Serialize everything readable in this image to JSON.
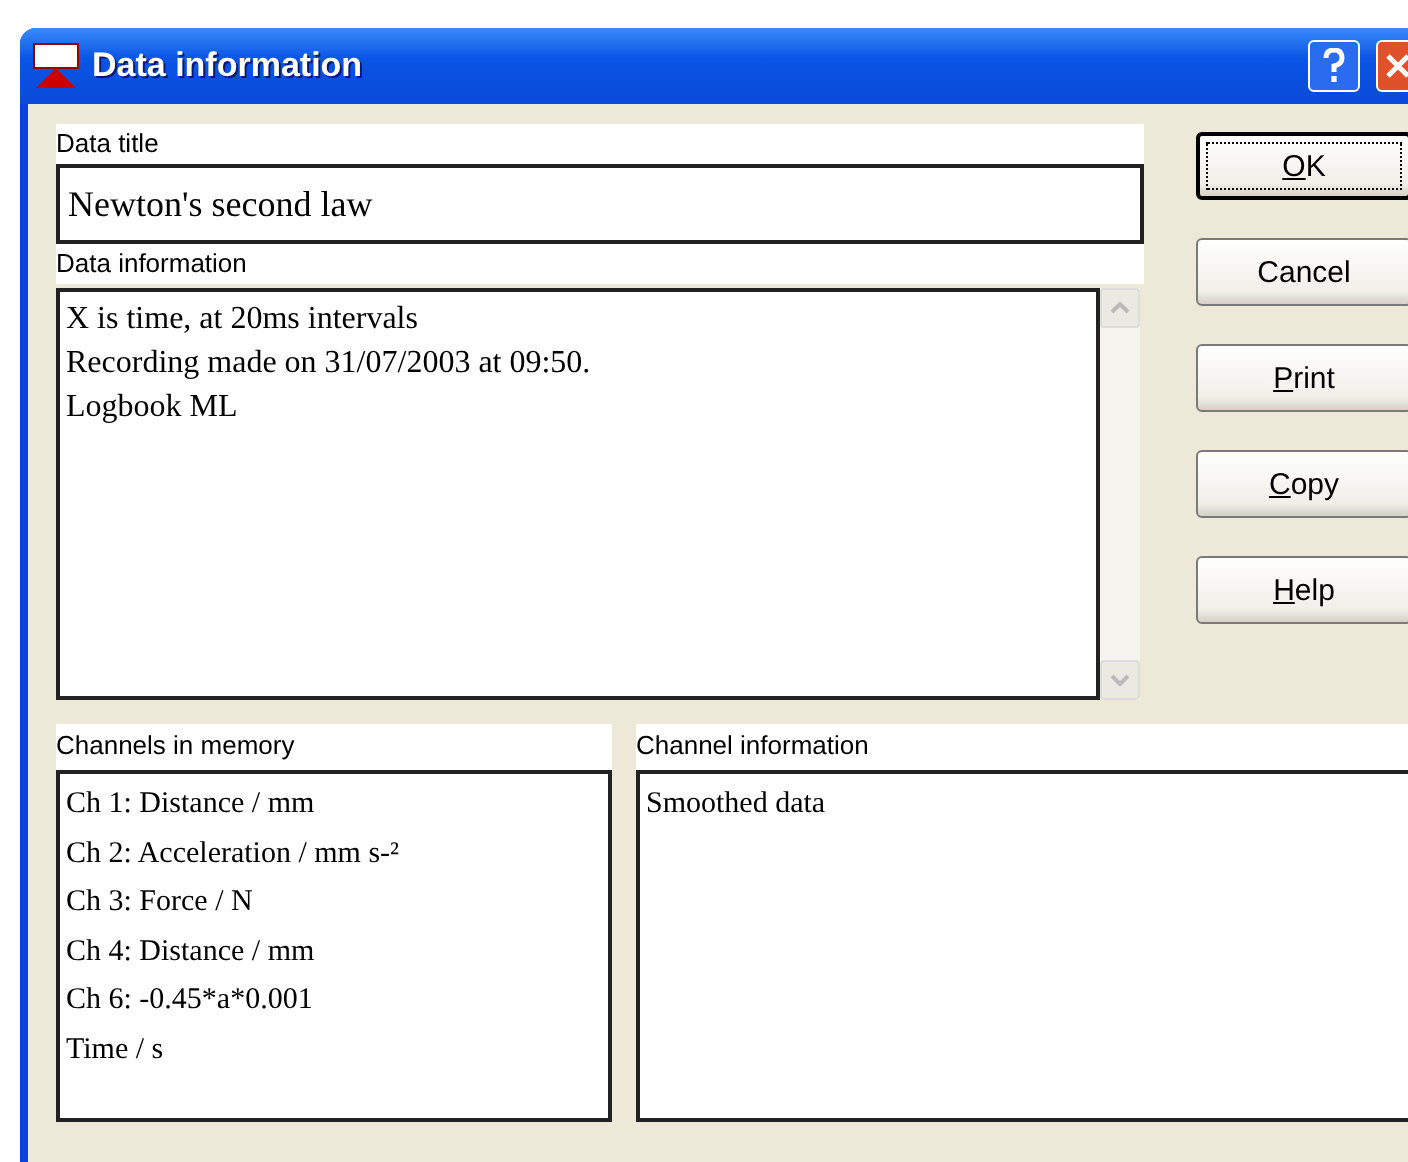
{
  "window": {
    "title": "Data information"
  },
  "data_title": {
    "label": "Data title",
    "value": "Newton's second law"
  },
  "data_information": {
    "label": "Data information",
    "lines": [
      "X is time, at 20ms intervals",
      "Recording made on 31/07/2003 at 09:50.",
      "Logbook ML"
    ]
  },
  "buttons": [
    {
      "label_parts": [
        {
          "text": "O",
          "underlined": true
        },
        {
          "text": "K",
          "underlined": false
        }
      ],
      "default": true
    },
    {
      "label_parts": [
        {
          "text": "Cancel",
          "underlined": false
        }
      ],
      "default": false
    },
    {
      "label_parts": [
        {
          "text": "P",
          "underlined": true
        },
        {
          "text": "rint",
          "underlined": false
        }
      ],
      "default": false
    },
    {
      "label_parts": [
        {
          "text": "C",
          "underlined": true
        },
        {
          "text": "opy",
          "underlined": false
        }
      ],
      "default": false
    },
    {
      "label_parts": [
        {
          "text": "H",
          "underlined": true
        },
        {
          "text": "elp",
          "underlined": false
        }
      ],
      "default": false
    }
  ],
  "channels_in_memory": {
    "label": "Channels in memory",
    "items": [
      "Ch 1: Distance / mm",
      "Ch 2: Acceleration / mm s-²",
      "Ch 3: Force / N",
      "Ch 4: Distance / mm",
      "Ch 6: -0.45*a*0.001",
      "Time / s"
    ]
  },
  "channel_information": {
    "label": "Channel information",
    "lines": [
      "Smoothed data"
    ]
  }
}
